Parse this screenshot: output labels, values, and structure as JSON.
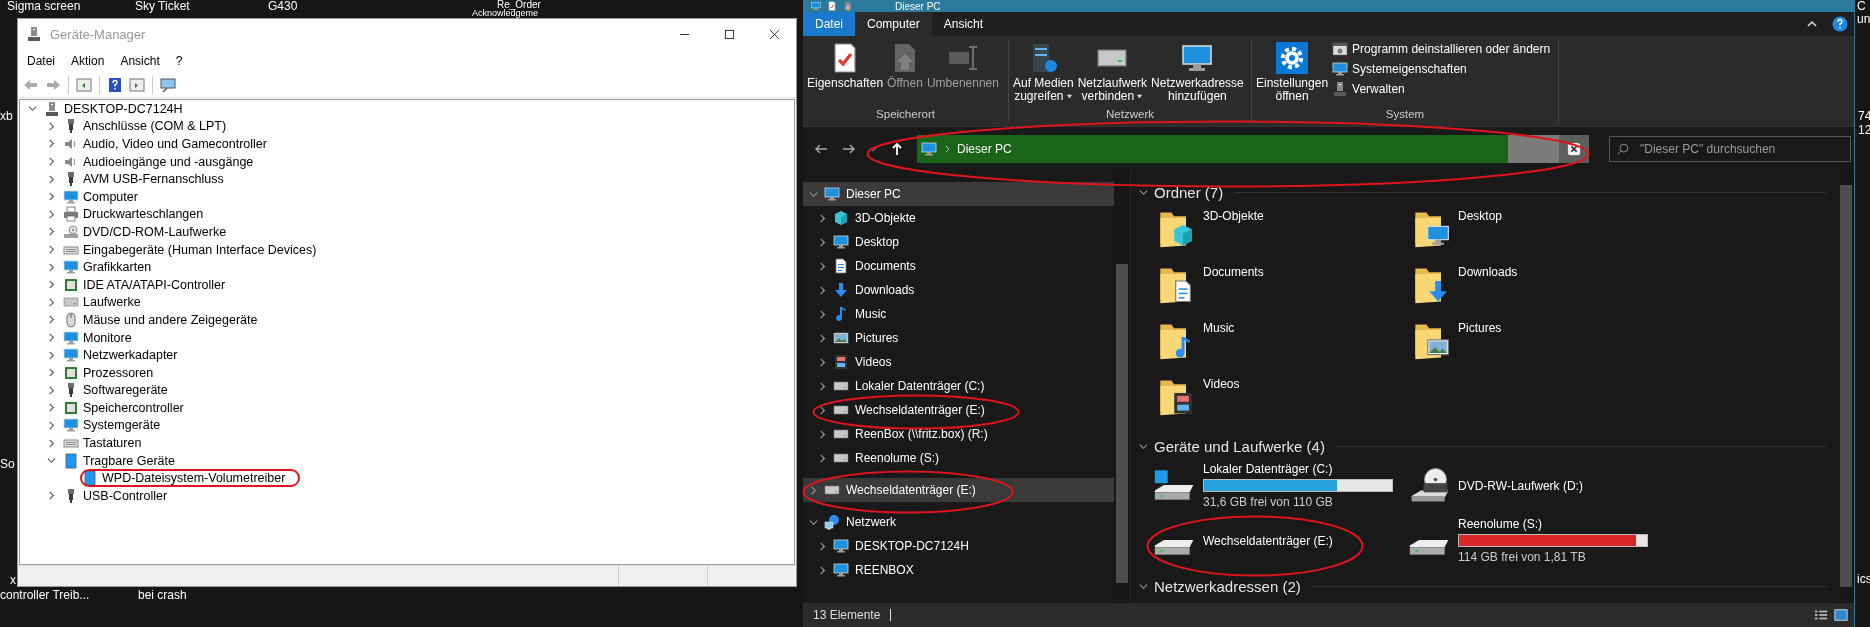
{
  "desktop": {
    "labels": [
      {
        "text": "Sigma screen"
      },
      {
        "text": "Sky Ticket"
      },
      {
        "text": "G430"
      },
      {
        "text": "Re_Order"
      },
      {
        "text": "Acknowledgeme"
      },
      {
        "text": "xb"
      },
      {
        "text": "So"
      },
      {
        "text": "x"
      },
      {
        "text": "controller Treib..."
      },
      {
        "text": "bei crash"
      },
      {
        "text": "C"
      },
      {
        "text": "un"
      },
      {
        "text": "74"
      },
      {
        "text": "12"
      },
      {
        "text": "ics"
      }
    ]
  },
  "device_manager": {
    "title": "Geräte-Manager",
    "menu": [
      "Datei",
      "Aktion",
      "Ansicht",
      "?"
    ],
    "tree": [
      {
        "label": "DESKTOP-DC7124H",
        "expanded": true,
        "children": [
          {
            "label": "Anschlüsse (COM & LPT)",
            "expanded": false
          },
          {
            "label": "Audio, Video und Gamecontroller",
            "expanded": false
          },
          {
            "label": "Audioeingänge und -ausgänge",
            "expanded": false
          },
          {
            "label": "AVM USB-Fernanschluss",
            "expanded": false
          },
          {
            "label": "Computer",
            "expanded": false
          },
          {
            "label": "Druckwarteschlangen",
            "expanded": false
          },
          {
            "label": "DVD/CD-ROM-Laufwerke",
            "expanded": false
          },
          {
            "label": "Eingabegeräte (Human Interface Devices)",
            "expanded": false
          },
          {
            "label": "Grafikkarten",
            "expanded": false
          },
          {
            "label": "IDE ATA/ATAPI-Controller",
            "expanded": false
          },
          {
            "label": "Laufwerke",
            "expanded": false
          },
          {
            "label": "Mäuse und andere Zeigegeräte",
            "expanded": false
          },
          {
            "label": "Monitore",
            "expanded": false
          },
          {
            "label": "Netzwerkadapter",
            "expanded": false
          },
          {
            "label": "Prozessoren",
            "expanded": false
          },
          {
            "label": "Softwaregeräte",
            "expanded": false
          },
          {
            "label": "Speichercontroller",
            "expanded": false
          },
          {
            "label": "Systemgeräte",
            "expanded": false
          },
          {
            "label": "Tastaturen",
            "expanded": false
          },
          {
            "label": "Tragbare Geräte",
            "expanded": true,
            "children": [
              {
                "label": "WPD-Dateisystem-Volumetreiber"
              }
            ]
          },
          {
            "label": "USB-Controller",
            "expanded": false
          }
        ]
      }
    ]
  },
  "explorer": {
    "title": "Dieser PC",
    "tabs": [
      {
        "label": "Datei",
        "kind": "file",
        "selected": false
      },
      {
        "label": "Computer",
        "kind": "tab",
        "selected": true
      },
      {
        "label": "Ansicht",
        "kind": "tab",
        "selected": false
      }
    ],
    "ribbon": [
      {
        "label": "Speicherort",
        "buttons": [
          {
            "label": "Eigenschaften",
            "disabled": false,
            "dropdown": false
          },
          {
            "label": "Öffnen",
            "disabled": true,
            "dropdown": false
          },
          {
            "label": "Umbenennen",
            "disabled": true,
            "dropdown": false
          }
        ]
      },
      {
        "label": "Netzwerk",
        "buttons": [
          {
            "label": "Auf Medien\nzugreifen",
            "disabled": false,
            "dropdown": true
          },
          {
            "label": "Netzlaufwerk\nverbinden",
            "disabled": false,
            "dropdown": true
          },
          {
            "label": "Netzwerkadresse\nhinzufügen",
            "disabled": false,
            "dropdown": false
          }
        ]
      },
      {
        "label": "System",
        "buttons": [
          {
            "label": "Einstellungen\nöffnen",
            "disabled": false,
            "dropdown": false
          }
        ],
        "small_buttons": [
          "Programm deinstallieren oder ändern",
          "Systemeigenschaften",
          "Verwalten"
        ]
      }
    ],
    "address": {
      "path": "Dieser PC",
      "level": 0.92
    },
    "search": {
      "placeholder": "\"Dieser PC\" durchsuchen"
    },
    "nav": [
      {
        "label": "Dieser PC",
        "expanded": true,
        "selected": true,
        "children": [
          {
            "label": "3D-Objekte",
            "expanded": false,
            "selected": false
          },
          {
            "label": "Desktop",
            "expanded": false,
            "selected": false
          },
          {
            "label": "Documents",
            "expanded": false,
            "selected": false
          },
          {
            "label": "Downloads",
            "expanded": false,
            "selected": false
          },
          {
            "label": "Music",
            "expanded": false,
            "selected": false
          },
          {
            "label": "Pictures",
            "expanded": false,
            "selected": false
          },
          {
            "label": "Videos",
            "expanded": false,
            "selected": false
          },
          {
            "label": "Lokaler Datenträger (C:)",
            "expanded": false,
            "selected": false
          },
          {
            "label": "Wechseldatenträger (E:)",
            "expanded": false,
            "selected": false
          },
          {
            "label": "ReenBox (\\\\fritz.box) (R:)",
            "expanded": false,
            "selected": false
          },
          {
            "label": "Reenolume (S:)",
            "expanded": false,
            "selected": false
          }
        ]
      },
      {
        "label": "Wechseldatenträger (E:)",
        "expanded": false,
        "selected": true
      },
      {
        "label": "Netzwerk",
        "expanded": true,
        "selected": false,
        "children": [
          {
            "label": "DESKTOP-DC7124H",
            "expanded": false,
            "selected": false
          },
          {
            "label": "REENBOX",
            "expanded": false,
            "selected": false
          }
        ]
      }
    ],
    "sections": [
      {
        "title": "Ordner (7)",
        "expanded": true,
        "items": [
          {
            "kind": "folder",
            "name": "3D-Objekte"
          },
          {
            "kind": "folder",
            "name": "Desktop"
          },
          {
            "kind": "folder",
            "name": "Documents"
          },
          {
            "kind": "folder",
            "name": "Downloads"
          },
          {
            "kind": "folder",
            "name": "Music"
          },
          {
            "kind": "folder",
            "name": "Pictures"
          },
          {
            "kind": "folder",
            "name": "Videos"
          }
        ]
      },
      {
        "title": "Geräte und Laufwerke (4)",
        "expanded": true,
        "items": [
          {
            "kind": "drive",
            "name": "Lokaler Datenträger (C:)",
            "level": 0.71,
            "free": "31,6 GB frei von 110 GB"
          },
          {
            "kind": "dvd",
            "name": "DVD-RW-Laufwerk (D:)"
          },
          {
            "kind": "drive",
            "name": "Wechseldatenträger (E:)"
          },
          {
            "kind": "drive",
            "name": "Reenolume (S:)",
            "level": 0.94,
            "free": "114 GB frei von 1,81 TB"
          }
        ]
      },
      {
        "title": "Netzwerkadressen (2)",
        "expanded": true
      }
    ],
    "status": "13 Elemente"
  }
}
